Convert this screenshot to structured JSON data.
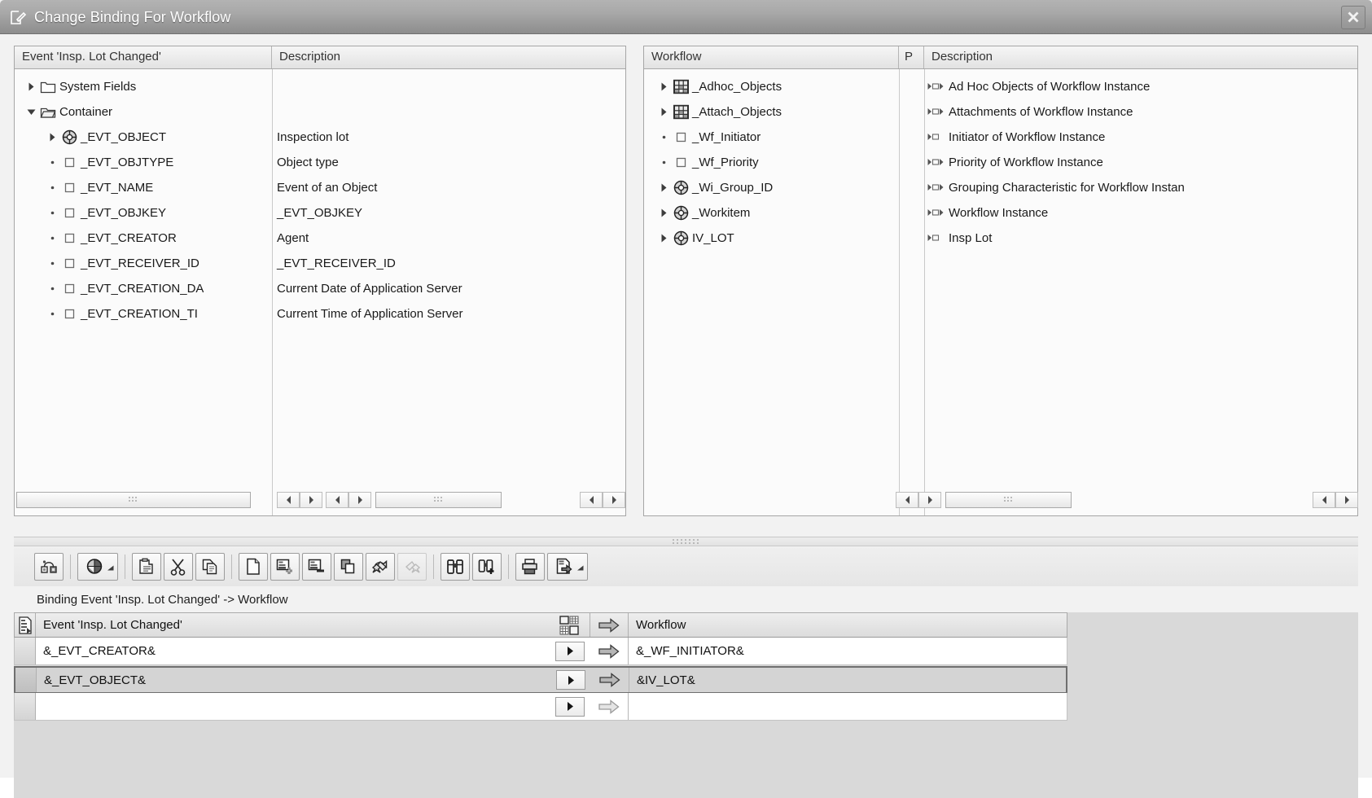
{
  "window": {
    "title": "Change Binding For Workflow",
    "title_icon": "edit-pencil-icon",
    "close_label": "✕"
  },
  "left_panel": {
    "columns": [
      "Event 'Insp. Lot Changed'",
      "Description"
    ],
    "rows": [
      {
        "indent": 0,
        "twisty": "collapsed",
        "icon": "folder-closed-icon",
        "name": "System Fields",
        "desc": ""
      },
      {
        "indent": 0,
        "twisty": "expanded",
        "icon": "folder-open-icon",
        "name": "Container",
        "desc": ""
      },
      {
        "indent": 1,
        "twisty": "collapsed",
        "icon": "object-reference-icon",
        "name": "_EVT_OBJECT",
        "desc": "Inspection lot"
      },
      {
        "indent": 1,
        "twisty": "leaf",
        "icon": "element-square-icon",
        "name": "_EVT_OBJTYPE",
        "desc": "Object type"
      },
      {
        "indent": 1,
        "twisty": "leaf",
        "icon": "element-square-icon",
        "name": "_EVT_NAME",
        "desc": "Event of an Object"
      },
      {
        "indent": 1,
        "twisty": "leaf",
        "icon": "element-square-icon",
        "name": "_EVT_OBJKEY",
        "desc": "_EVT_OBJKEY"
      },
      {
        "indent": 1,
        "twisty": "leaf",
        "icon": "element-square-icon",
        "name": "_EVT_CREATOR",
        "desc": "Agent"
      },
      {
        "indent": 1,
        "twisty": "leaf",
        "icon": "element-square-icon",
        "name": "_EVT_RECEIVER_ID",
        "desc": "_EVT_RECEIVER_ID"
      },
      {
        "indent": 1,
        "twisty": "leaf",
        "icon": "element-square-icon",
        "name": "_EVT_CREATION_DA",
        "desc": "Current Date of Application Server"
      },
      {
        "indent": 1,
        "twisty": "leaf",
        "icon": "element-square-icon",
        "name": "_EVT_CREATION_TI",
        "desc": "Current Time of Application Server"
      }
    ]
  },
  "right_panel": {
    "columns": [
      "Workflow",
      "P",
      "Description"
    ],
    "rows": [
      {
        "twisty": "collapsed",
        "icon": "table-multiline-icon",
        "name": "_Adhoc_Objects",
        "flags": "both",
        "desc": "Ad Hoc Objects of Workflow Instance"
      },
      {
        "twisty": "collapsed",
        "icon": "table-multiline-icon",
        "name": "_Attach_Objects",
        "flags": "both",
        "desc": "Attachments of Workflow Instance"
      },
      {
        "twisty": "leaf",
        "icon": "element-square-icon",
        "name": "_Wf_Initiator",
        "flags": "import",
        "desc": "Initiator of Workflow Instance"
      },
      {
        "twisty": "leaf",
        "icon": "element-square-icon",
        "name": "_Wf_Priority",
        "flags": "both",
        "desc": "Priority of Workflow Instance"
      },
      {
        "twisty": "collapsed",
        "icon": "object-reference-icon",
        "name": "_Wi_Group_ID",
        "flags": "both",
        "desc": "Grouping Characteristic for Workflow Instan"
      },
      {
        "twisty": "collapsed",
        "icon": "object-reference-icon",
        "name": "_Workitem",
        "flags": "both",
        "desc": "Workflow Instance"
      },
      {
        "twisty": "collapsed",
        "icon": "object-reference-icon",
        "name": "IV_LOT",
        "flags": "import",
        "desc": "Insp Lot"
      }
    ]
  },
  "toolbar": {
    "buttons": [
      {
        "name": "binding-editor-icon",
        "tip": "Binding Editor",
        "dropdown": false,
        "disabled": false
      },
      {
        "sep": true
      },
      {
        "name": "globe-icon",
        "tip": "Expression",
        "dropdown": true,
        "disabled": false
      },
      {
        "sep": true
      },
      {
        "name": "paste-clipboard-icon",
        "tip": "Paste",
        "dropdown": false,
        "disabled": false
      },
      {
        "name": "scissors-cut-icon",
        "tip": "Cut",
        "dropdown": false,
        "disabled": false
      },
      {
        "name": "copy-pages-icon",
        "tip": "Copy",
        "dropdown": false,
        "disabled": false
      },
      {
        "sep": true
      },
      {
        "name": "new-document-icon",
        "tip": "New",
        "dropdown": false,
        "disabled": false
      },
      {
        "name": "insert-row-icon",
        "tip": "Insert Row",
        "dropdown": false,
        "disabled": false
      },
      {
        "name": "delete-row-icon",
        "tip": "Delete Row",
        "dropdown": false,
        "disabled": false
      },
      {
        "name": "duplicate-icon",
        "tip": "Duplicate",
        "dropdown": false,
        "disabled": false
      },
      {
        "name": "undo-icon",
        "tip": "Undo",
        "dropdown": false,
        "disabled": false
      },
      {
        "name": "redo-icon",
        "tip": "Redo",
        "dropdown": false,
        "disabled": true
      },
      {
        "sep": true
      },
      {
        "name": "find-binoculars-icon",
        "tip": "Find",
        "dropdown": false,
        "disabled": false
      },
      {
        "name": "find-next-icon",
        "tip": "Find Next",
        "dropdown": false,
        "disabled": false
      },
      {
        "sep": true
      },
      {
        "name": "print-icon",
        "tip": "Print",
        "dropdown": false,
        "disabled": false
      },
      {
        "name": "export-document-icon",
        "tip": "Export",
        "dropdown": true,
        "disabled": false
      }
    ]
  },
  "binding": {
    "label": "Binding Event 'Insp. Lot Changed' -> Workflow",
    "header": {
      "gutter_icon": "table-detail-icon",
      "source": "Event 'Insp. Lot Changed'",
      "mapping_icon": "grid-mapping-icon",
      "arrow_icon": "arrow-right-icon",
      "target": "Workflow"
    },
    "rows": [
      {
        "source": "&_EVT_CREATOR&",
        "target": "&_WF_INITIATOR&",
        "selected": false,
        "arrow_active": true
      },
      {
        "source": "&_EVT_OBJECT&",
        "target": "&IV_LOT&",
        "selected": true,
        "arrow_active": true
      },
      {
        "source": "",
        "target": "",
        "selected": false,
        "arrow_active": false
      }
    ]
  },
  "scrollbars": {
    "left_grip": "drag-grip-icon",
    "right_grip": "drag-grip-icon",
    "left_arrow": "◀",
    "right_arrow": "▶"
  }
}
